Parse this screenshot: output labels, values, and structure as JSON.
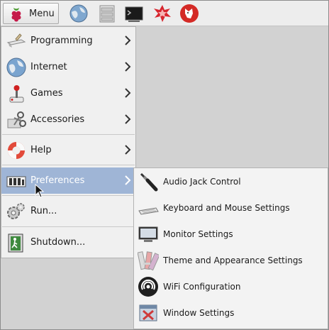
{
  "taskbar": {
    "menu_label": "Menu",
    "launchers": [
      "globe-icon",
      "file-manager-icon",
      "terminal-icon",
      "mathematica-icon",
      "wolfram-icon"
    ]
  },
  "main_menu": {
    "items": [
      {
        "label": "Programming",
        "icon": "programming-icon",
        "submenu": true
      },
      {
        "label": "Internet",
        "icon": "internet-icon",
        "submenu": true
      },
      {
        "label": "Games",
        "icon": "games-icon",
        "submenu": true
      },
      {
        "label": "Accessories",
        "icon": "accessories-icon",
        "submenu": true
      },
      {
        "label": "Help",
        "icon": "help-icon",
        "submenu": true
      },
      {
        "label": "Preferences",
        "icon": "preferences-icon",
        "submenu": true,
        "active": true
      },
      {
        "label": "Run...",
        "icon": "run-icon",
        "submenu": false
      },
      {
        "label": "Shutdown...",
        "icon": "shutdown-icon",
        "submenu": false
      }
    ]
  },
  "preferences_submenu": {
    "items": [
      {
        "label": "Audio Jack Control",
        "icon": "audio-jack-icon"
      },
      {
        "label": "Keyboard and Mouse Settings",
        "icon": "keyboard-icon"
      },
      {
        "label": "Monitor Settings",
        "icon": "monitor-icon"
      },
      {
        "label": "Theme and Appearance Settings",
        "icon": "theme-icon"
      },
      {
        "label": "WiFi Configuration",
        "icon": "wifi-icon"
      },
      {
        "label": "Window Settings",
        "icon": "window-settings-icon"
      }
    ]
  },
  "colors": {
    "highlight": "#9fb5d6",
    "desktop": "#d2d2d2",
    "menu_bg": "#f0f0f0"
  }
}
